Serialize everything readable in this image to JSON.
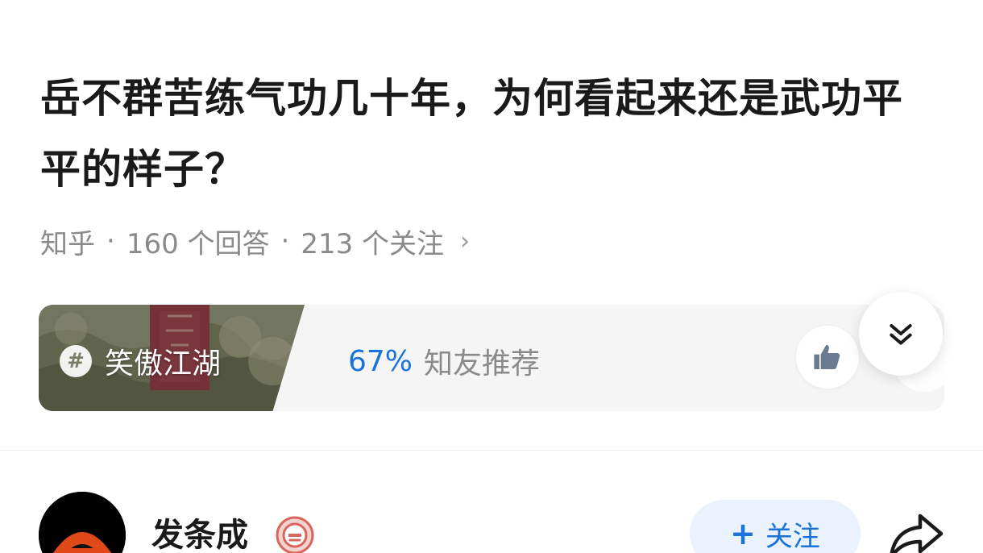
{
  "question": {
    "title": "岳不群苦练气功几十年，为何看起来还是武功平平的样子？",
    "source": "知乎",
    "separator": "·",
    "answers_text": "160 个回答",
    "followers_text": "213 个关注",
    "chevron": "›"
  },
  "topic_card": {
    "tag_icon_text": "#",
    "tag_name": "笑傲江湖",
    "recommend_percent": "67%",
    "recommend_label": "知友推荐",
    "cover_icon": "book-cover-image",
    "like_icon": "thumbs-up-icon",
    "expand_icon": "double-chevron-down-icon"
  },
  "author": {
    "name": "发条成",
    "avatar_icon": "clockwork-orange-avatar",
    "badge_icon": "medal-badge-icon"
  },
  "actions": {
    "follow_plus": "+",
    "follow_label": "关注",
    "share_icon": "share-arrow-icon"
  },
  "colors": {
    "accent": "#1a73d9",
    "follow_bg": "#eaf2fd",
    "meta_text": "#8a8a8a",
    "card_bg": "#f5f5f5"
  }
}
